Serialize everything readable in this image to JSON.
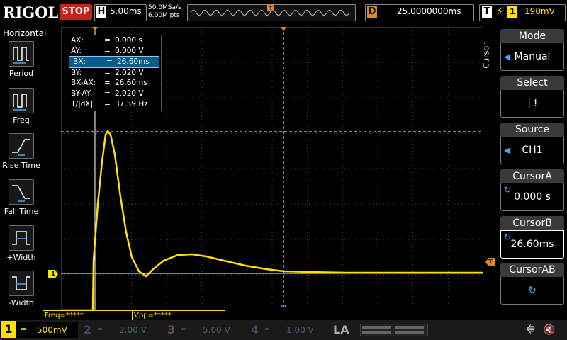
{
  "top": {
    "logo": "RIGOL",
    "run_state": "STOP",
    "h_letter": "H",
    "timebase": "5.00ms",
    "sample_rate": "50.0MSa/s",
    "memory_depth": "6.00M pts",
    "delay_letter": "D",
    "delay_value": "25.0000000ms",
    "trigger_letter": "T",
    "trigger_source": "1",
    "trigger_level": "190mV"
  },
  "left_panel": {
    "title": "Horizontal",
    "items": [
      {
        "label": "Period"
      },
      {
        "label": "Freq"
      },
      {
        "label": "Rise Time"
      },
      {
        "label": "Fall Time"
      },
      {
        "label": "+Width"
      },
      {
        "label": "-Width"
      }
    ]
  },
  "cursor_readout": [
    {
      "key": "AX:",
      "eq": "=",
      "value": "0.000 s"
    },
    {
      "key": "AY:",
      "eq": "=",
      "value": "0.000 V"
    },
    {
      "key": "BX:",
      "eq": "=",
      "value": "26.60ms"
    },
    {
      "key": "BY:",
      "eq": "=",
      "value": "2.020 V"
    },
    {
      "key": "BX-AX:",
      "eq": "=",
      "value": "26.60ms"
    },
    {
      "key": "BY-AY:",
      "eq": "=",
      "value": "2.020 V"
    },
    {
      "key": "1/|dX|:",
      "eq": "=",
      "value": "37.59 Hz"
    }
  ],
  "right_menu": {
    "side_label": "Cursor",
    "items": [
      {
        "title": "Mode",
        "value": "Manual"
      },
      {
        "title": "Select",
        "value": "|   ⁞"
      },
      {
        "title": "Source",
        "value": "CH1"
      },
      {
        "title": "CursorA",
        "value": "0.000 s"
      },
      {
        "title": "CursorB",
        "value": "26.60ms"
      },
      {
        "title": "CursorAB",
        "value": "↻"
      }
    ]
  },
  "measure": {
    "freq": "Freq=*****",
    "vpp": "Vpp=*****"
  },
  "channels": [
    {
      "num": "1",
      "scale": "500mV",
      "color": "#ffe000"
    },
    {
      "num": "2",
      "scale": "2.00 V",
      "color": "#00c0c0"
    },
    {
      "num": "3",
      "scale": "5.00 V",
      "color": "#e040e0"
    },
    {
      "num": "4",
      "scale": "1.00 V",
      "color": "#3a7cff"
    }
  ],
  "la_label": "LA",
  "ch1_marker": "1",
  "trigger_marker": "T",
  "icons": {
    "usb": "usb-icon",
    "sound": "speaker-mute-icon"
  }
}
